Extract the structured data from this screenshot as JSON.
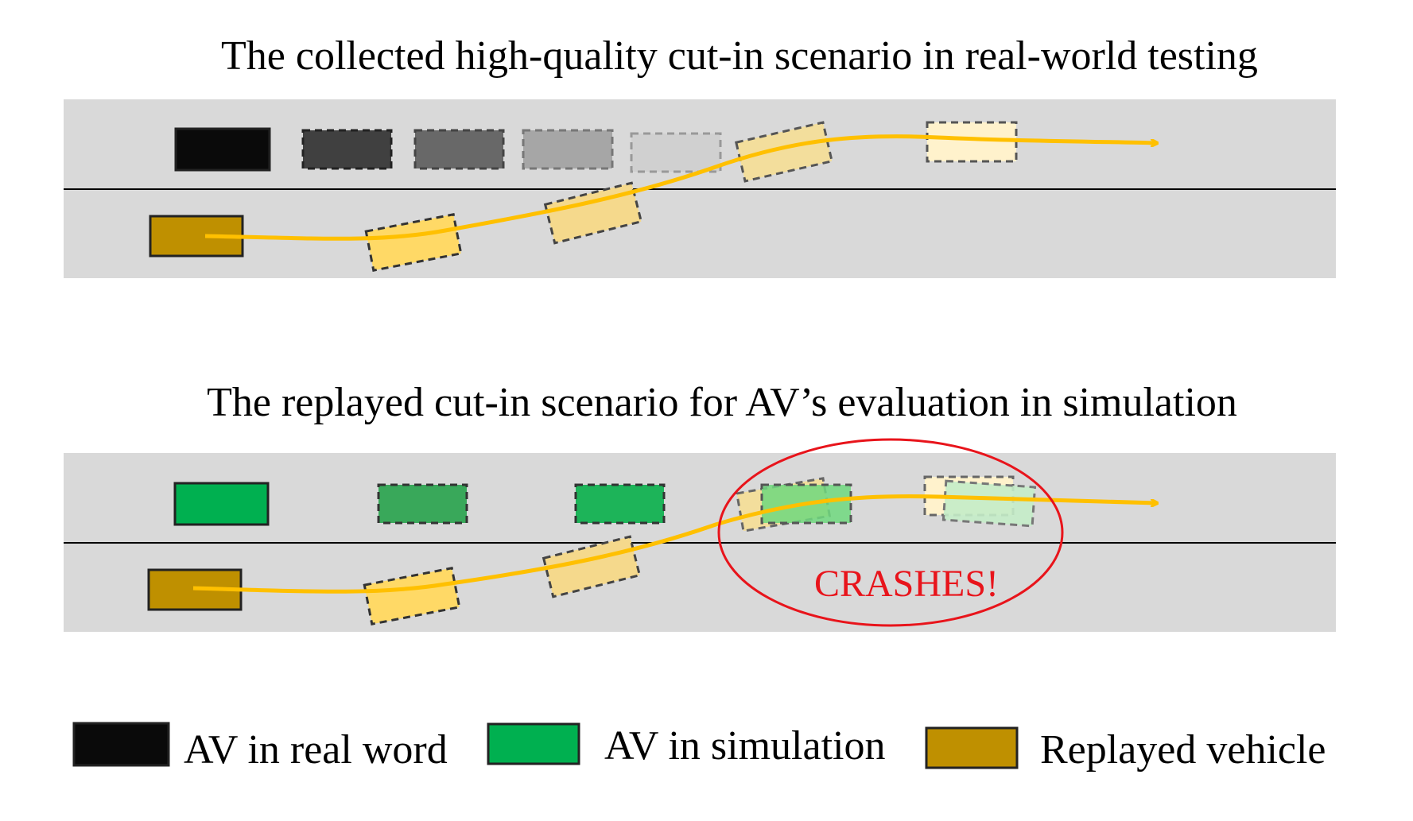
{
  "panels": [
    {
      "title": "The collected high-quality cut-in scenario in real-world testing"
    },
    {
      "title": "The replayed cut-in scenario for AV’s evaluation in simulation"
    }
  ],
  "annotation": {
    "text": "CRASHES!",
    "color": "#e8141b"
  },
  "legend": [
    {
      "label": "AV in real word",
      "color": "#0a0a0a"
    },
    {
      "label": "AV in simulation",
      "color": "#00b050"
    },
    {
      "label": "Replayed vehicle",
      "color": "#bf9000"
    }
  ],
  "colors": {
    "road": "#d9d9d9",
    "lane_line": "#000000",
    "trajectory": "#ffc000",
    "crash_circle": "#e8141b"
  }
}
